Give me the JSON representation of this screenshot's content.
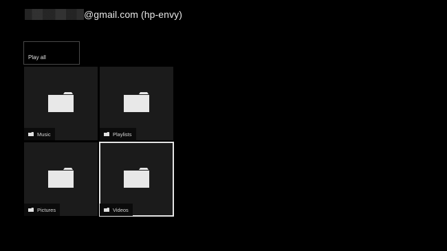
{
  "header": {
    "account_suffix": "@gmail.com (hp-envy)"
  },
  "actions": {
    "play_all_label": "Play all"
  },
  "folders": [
    {
      "label": "Music",
      "icon": "folder-icon"
    },
    {
      "label": "Playlists",
      "icon": "folder-icon"
    },
    {
      "label": "Pictures",
      "icon": "folder-icon"
    },
    {
      "label": "Videos",
      "icon": "folder-icon",
      "selected": true
    }
  ],
  "colors": {
    "background": "#000000",
    "tile": "#1b1b1b",
    "label_bar": "#0b0b0b",
    "selection": "#e6e6e6",
    "folder_icon": "#e8e8e8"
  }
}
